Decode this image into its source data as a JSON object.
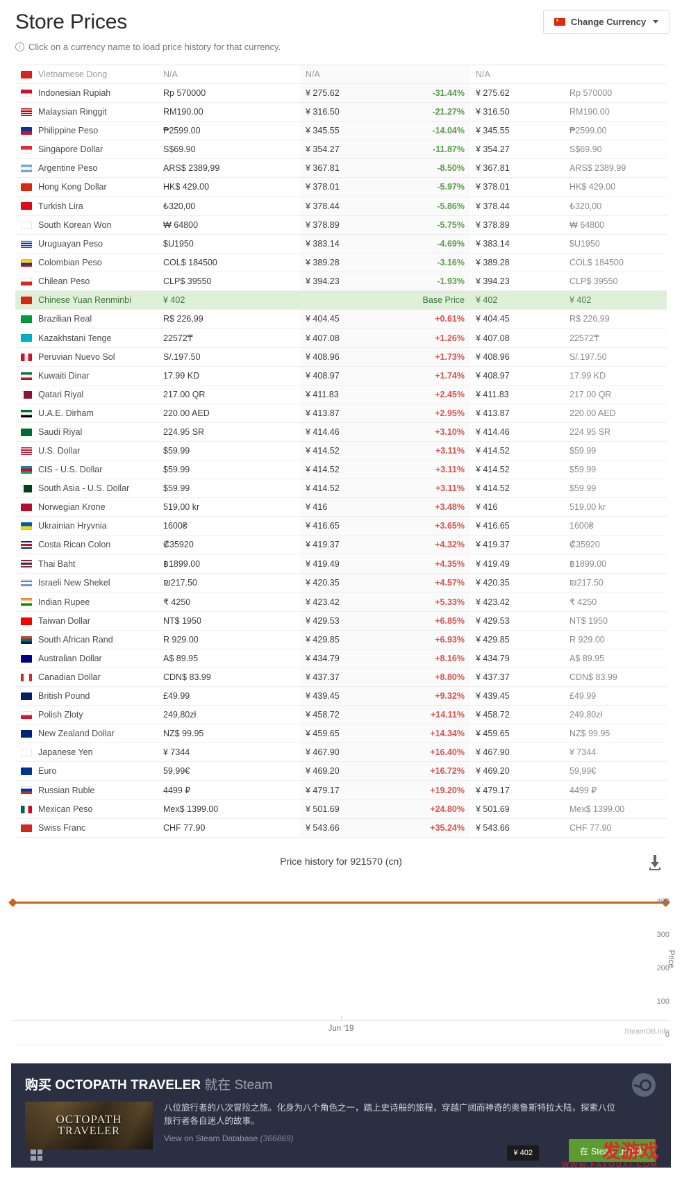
{
  "header": {
    "title": "Store Prices",
    "currency_button": "Change Currency",
    "currency_flag": "cn",
    "hint": "Click on a currency name to load price history for that currency."
  },
  "table": {
    "rows": [
      {
        "flag": "vn",
        "name": "Vietnamese Dong",
        "local": "N/A",
        "converted": "N/A",
        "diff": "",
        "lowest": "N/A",
        "lowest_local": "",
        "state": "na"
      },
      {
        "flag": "id",
        "name": "Indonesian Rupiah",
        "local": "Rp 570000",
        "converted": "¥ 275.62",
        "diff": "-31.44%",
        "lowest": "¥ 275.62",
        "lowest_local": "Rp 570000",
        "state": "neg"
      },
      {
        "flag": "my",
        "name": "Malaysian Ringgit",
        "local": "RM190.00",
        "converted": "¥ 316.50",
        "diff": "-21.27%",
        "lowest": "¥ 316.50",
        "lowest_local": "RM190.00",
        "state": "neg"
      },
      {
        "flag": "ph",
        "name": "Philippine Peso",
        "local": "₱2599.00",
        "converted": "¥ 345.55",
        "diff": "-14.04%",
        "lowest": "¥ 345.55",
        "lowest_local": "₱2599.00",
        "state": "neg"
      },
      {
        "flag": "sg",
        "name": "Singapore Dollar",
        "local": "S$69.90",
        "converted": "¥ 354.27",
        "diff": "-11.87%",
        "lowest": "¥ 354.27",
        "lowest_local": "S$69.90",
        "state": "neg"
      },
      {
        "flag": "ar",
        "name": "Argentine Peso",
        "local": "ARS$ 2389,99",
        "converted": "¥ 367.81",
        "diff": "-8.50%",
        "lowest": "¥ 367.81",
        "lowest_local": "ARS$ 2389,99",
        "state": "neg"
      },
      {
        "flag": "hk",
        "name": "Hong Kong Dollar",
        "local": "HK$ 429.00",
        "converted": "¥ 378.01",
        "diff": "-5.97%",
        "lowest": "¥ 378.01",
        "lowest_local": "HK$ 429.00",
        "state": "neg"
      },
      {
        "flag": "tr",
        "name": "Turkish Lira",
        "local": "₺320,00",
        "converted": "¥ 378.44",
        "diff": "-5.86%",
        "lowest": "¥ 378.44",
        "lowest_local": "₺320,00",
        "state": "neg"
      },
      {
        "flag": "kr",
        "name": "South Korean Won",
        "local": "₩ 64800",
        "converted": "¥ 378.89",
        "diff": "-5.75%",
        "lowest": "¥ 378.89",
        "lowest_local": "₩ 64800",
        "state": "neg"
      },
      {
        "flag": "uy",
        "name": "Uruguayan Peso",
        "local": "$U1950",
        "converted": "¥ 383.14",
        "diff": "-4.69%",
        "lowest": "¥ 383.14",
        "lowest_local": "$U1950",
        "state": "neg"
      },
      {
        "flag": "co",
        "name": "Colombian Peso",
        "local": "COL$ 184500",
        "converted": "¥ 389.28",
        "diff": "-3.16%",
        "lowest": "¥ 389.28",
        "lowest_local": "COL$ 184500",
        "state": "neg"
      },
      {
        "flag": "cl",
        "name": "Chilean Peso",
        "local": "CLP$ 39550",
        "converted": "¥ 394.23",
        "diff": "-1.93%",
        "lowest": "¥ 394.23",
        "lowest_local": "CLP$ 39550",
        "state": "neg"
      },
      {
        "flag": "cn",
        "name": "Chinese Yuan Renminbi",
        "local": "¥ 402",
        "converted": "",
        "diff": "Base Price",
        "lowest": "¥ 402",
        "lowest_local": "¥ 402",
        "state": "base"
      },
      {
        "flag": "br",
        "name": "Brazilian Real",
        "local": "R$ 226,99",
        "converted": "¥ 404.45",
        "diff": "+0.61%",
        "lowest": "¥ 404.45",
        "lowest_local": "R$ 226,99",
        "state": "pos"
      },
      {
        "flag": "kz",
        "name": "Kazakhstani Tenge",
        "local": "22572₸",
        "converted": "¥ 407.08",
        "diff": "+1.26%",
        "lowest": "¥ 407.08",
        "lowest_local": "22572₸",
        "state": "pos"
      },
      {
        "flag": "pe",
        "name": "Peruvian Nuevo Sol",
        "local": "S/.197.50",
        "converted": "¥ 408.96",
        "diff": "+1.73%",
        "lowest": "¥ 408.96",
        "lowest_local": "S/.197.50",
        "state": "pos"
      },
      {
        "flag": "kw",
        "name": "Kuwaiti Dinar",
        "local": "17.99 KD",
        "converted": "¥ 408.97",
        "diff": "+1.74%",
        "lowest": "¥ 408.97",
        "lowest_local": "17.99 KD",
        "state": "pos"
      },
      {
        "flag": "qa",
        "name": "Qatari Riyal",
        "local": "217.00 QR",
        "converted": "¥ 411.83",
        "diff": "+2.45%",
        "lowest": "¥ 411.83",
        "lowest_local": "217.00 QR",
        "state": "pos"
      },
      {
        "flag": "ae",
        "name": "U.A.E. Dirham",
        "local": "220.00 AED",
        "converted": "¥ 413.87",
        "diff": "+2.95%",
        "lowest": "¥ 413.87",
        "lowest_local": "220.00 AED",
        "state": "pos"
      },
      {
        "flag": "sa",
        "name": "Saudi Riyal",
        "local": "224.95 SR",
        "converted": "¥ 414.46",
        "diff": "+3.10%",
        "lowest": "¥ 414.46",
        "lowest_local": "224.95 SR",
        "state": "pos"
      },
      {
        "flag": "us",
        "name": "U.S. Dollar",
        "local": "$59.99",
        "converted": "¥ 414.52",
        "diff": "+3.11%",
        "lowest": "¥ 414.52",
        "lowest_local": "$59.99",
        "state": "pos"
      },
      {
        "flag": "az",
        "name": "CIS - U.S. Dollar",
        "local": "$59.99",
        "converted": "¥ 414.52",
        "diff": "+3.11%",
        "lowest": "¥ 414.52",
        "lowest_local": "$59.99",
        "state": "pos"
      },
      {
        "flag": "pk",
        "name": "South Asia - U.S. Dollar",
        "local": "$59.99",
        "converted": "¥ 414.52",
        "diff": "+3.11%",
        "lowest": "¥ 414.52",
        "lowest_local": "$59.99",
        "state": "pos"
      },
      {
        "flag": "no",
        "name": "Norwegian Krone",
        "local": "519,00 kr",
        "converted": "¥ 416",
        "diff": "+3.48%",
        "lowest": "¥ 416",
        "lowest_local": "519,00 kr",
        "state": "pos"
      },
      {
        "flag": "ua",
        "name": "Ukrainian Hryvnia",
        "local": "1600₴",
        "converted": "¥ 416.65",
        "diff": "+3.65%",
        "lowest": "¥ 416.65",
        "lowest_local": "1600₴",
        "state": "pos"
      },
      {
        "flag": "cr",
        "name": "Costa Rican Colon",
        "local": "₡35920",
        "converted": "¥ 419.37",
        "diff": "+4.32%",
        "lowest": "¥ 419.37",
        "lowest_local": "₡35920",
        "state": "pos"
      },
      {
        "flag": "th",
        "name": "Thai Baht",
        "local": "฿1899.00",
        "converted": "¥ 419.49",
        "diff": "+4.35%",
        "lowest": "¥ 419.49",
        "lowest_local": "฿1899.00",
        "state": "pos"
      },
      {
        "flag": "il",
        "name": "Israeli New Shekel",
        "local": "₪217.50",
        "converted": "¥ 420.35",
        "diff": "+4.57%",
        "lowest": "¥ 420.35",
        "lowest_local": "₪217.50",
        "state": "pos"
      },
      {
        "flag": "in",
        "name": "Indian Rupee",
        "local": "₹ 4250",
        "converted": "¥ 423.42",
        "diff": "+5.33%",
        "lowest": "¥ 423.42",
        "lowest_local": "₹ 4250",
        "state": "pos"
      },
      {
        "flag": "tw",
        "name": "Taiwan Dollar",
        "local": "NT$ 1950",
        "converted": "¥ 429.53",
        "diff": "+6.85%",
        "lowest": "¥ 429.53",
        "lowest_local": "NT$ 1950",
        "state": "pos"
      },
      {
        "flag": "za",
        "name": "South African Rand",
        "local": "R 929.00",
        "converted": "¥ 429.85",
        "diff": "+6.93%",
        "lowest": "¥ 429.85",
        "lowest_local": "R 929.00",
        "state": "pos"
      },
      {
        "flag": "au",
        "name": "Australian Dollar",
        "local": "A$ 89.95",
        "converted": "¥ 434.79",
        "diff": "+8.16%",
        "lowest": "¥ 434.79",
        "lowest_local": "A$ 89.95",
        "state": "pos"
      },
      {
        "flag": "ca",
        "name": "Canadian Dollar",
        "local": "CDN$ 83.99",
        "converted": "¥ 437.37",
        "diff": "+8.80%",
        "lowest": "¥ 437.37",
        "lowest_local": "CDN$ 83.99",
        "state": "pos"
      },
      {
        "flag": "gb",
        "name": "British Pound",
        "local": "£49.99",
        "converted": "¥ 439.45",
        "diff": "+9.32%",
        "lowest": "¥ 439.45",
        "lowest_local": "£49.99",
        "state": "pos"
      },
      {
        "flag": "pl",
        "name": "Polish Zloty",
        "local": "249,80zł",
        "converted": "¥ 458.72",
        "diff": "+14.11%",
        "lowest": "¥ 458.72",
        "lowest_local": "249,80zł",
        "state": "pos"
      },
      {
        "flag": "nz",
        "name": "New Zealand Dollar",
        "local": "NZ$ 99.95",
        "converted": "¥ 459.65",
        "diff": "+14.34%",
        "lowest": "¥ 459.65",
        "lowest_local": "NZ$ 99.95",
        "state": "pos"
      },
      {
        "flag": "jp",
        "name": "Japanese Yen",
        "local": "¥ 7344",
        "converted": "¥ 467.90",
        "diff": "+16.40%",
        "lowest": "¥ 467.90",
        "lowest_local": "¥ 7344",
        "state": "pos"
      },
      {
        "flag": "eu",
        "name": "Euro",
        "local": "59,99€",
        "converted": "¥ 469.20",
        "diff": "+16.72%",
        "lowest": "¥ 469.20",
        "lowest_local": "59,99€",
        "state": "pos"
      },
      {
        "flag": "ru",
        "name": "Russian Ruble",
        "local": "4499 ₽",
        "converted": "¥ 479.17",
        "diff": "+19.20%",
        "lowest": "¥ 479.17",
        "lowest_local": "4499 ₽",
        "state": "pos"
      },
      {
        "flag": "mx",
        "name": "Mexican Peso",
        "local": "Mex$ 1399.00",
        "converted": "¥ 501.69",
        "diff": "+24.80%",
        "lowest": "¥ 501.69",
        "lowest_local": "Mex$ 1399.00",
        "state": "pos"
      },
      {
        "flag": "ch",
        "name": "Swiss Franc",
        "local": "CHF 77.90",
        "converted": "¥ 543.66",
        "diff": "+35.24%",
        "lowest": "¥ 543.66",
        "lowest_local": "CHF 77.90",
        "state": "pos"
      }
    ]
  },
  "chart_data": {
    "type": "line",
    "title": "Price history for 921570 (cn)",
    "xlabel": "",
    "ylabel": "Price",
    "x_tick_labels": [
      "Jun '19"
    ],
    "y_ticks": [
      400,
      300,
      200,
      100,
      0
    ],
    "ylim": [
      0,
      430
    ],
    "grid": false,
    "legend": "none",
    "line_color": "#c8641e",
    "watermark": "SteamDB.info",
    "series": [
      {
        "name": "Price (cn)",
        "x": [
          "start",
          "end"
        ],
        "values": [
          402,
          402
        ]
      }
    ]
  },
  "steam_banner": {
    "title_cn_1": "购买",
    "title_game": "OCTOPATH TRAVELER",
    "title_cn_2": "就在",
    "title_steam": "Steam",
    "capsule_line1": "OCTOPATH",
    "capsule_line2": "TRAVELER",
    "description": "八位旅行者的八次冒险之旅。化身为八个角色之一，踏上史诗般的旅程，穿越广阔而神奇的奥鲁斯特拉大陆，探索八位旅行者各自迷人的故事。",
    "link_text": "View on Steam Database",
    "link_id": "(366869)"
  },
  "overlays": {
    "tooltip_price": "¥ 402",
    "buy_button": "在 Steam 上购买",
    "watermark_big": "发游戏",
    "watermark_small": "WWW.FAYOUXI.COM"
  }
}
